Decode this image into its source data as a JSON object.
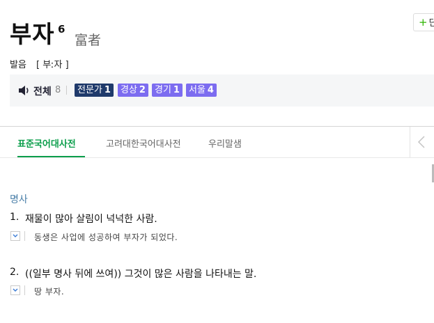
{
  "entry": {
    "word": "부자",
    "homonym_number": "6",
    "hanja": "富者",
    "pronunciation_label": "발음",
    "pronunciation_value": "[ 부ː자 ]",
    "add_button_label": "단"
  },
  "audio": {
    "all_label": "전체",
    "all_count": "8",
    "dialects": [
      {
        "label": "전문가",
        "count": "1",
        "color": "#1f3a6b"
      },
      {
        "label": "경상",
        "count": "2",
        "color": "#7c6cf0"
      },
      {
        "label": "경기",
        "count": "1",
        "color": "#7c6cf0"
      },
      {
        "label": "서울",
        "count": "4",
        "color": "#7c6cf0"
      }
    ]
  },
  "tabs": [
    {
      "label": "표준국어대사전",
      "active": true
    },
    {
      "label": "고려대한국어대사전",
      "active": false
    },
    {
      "label": "우리말샘",
      "active": false
    }
  ],
  "senses": {
    "part_of_speech": "명사",
    "items": [
      {
        "number": "1.",
        "definition": "재물이 많아 살림이 넉넉한 사람.",
        "example": "동생은 사업에 성공하여 부자가 되었다."
      },
      {
        "number": "2.",
        "definition": "((일부 명사 뒤에 쓰여)) 그것이 많은 사람을 나타내는 말.",
        "example": "땅 부자."
      }
    ]
  },
  "colors": {
    "accent_green": "#0b9e4b",
    "pos_blue": "#4a7fa8"
  }
}
